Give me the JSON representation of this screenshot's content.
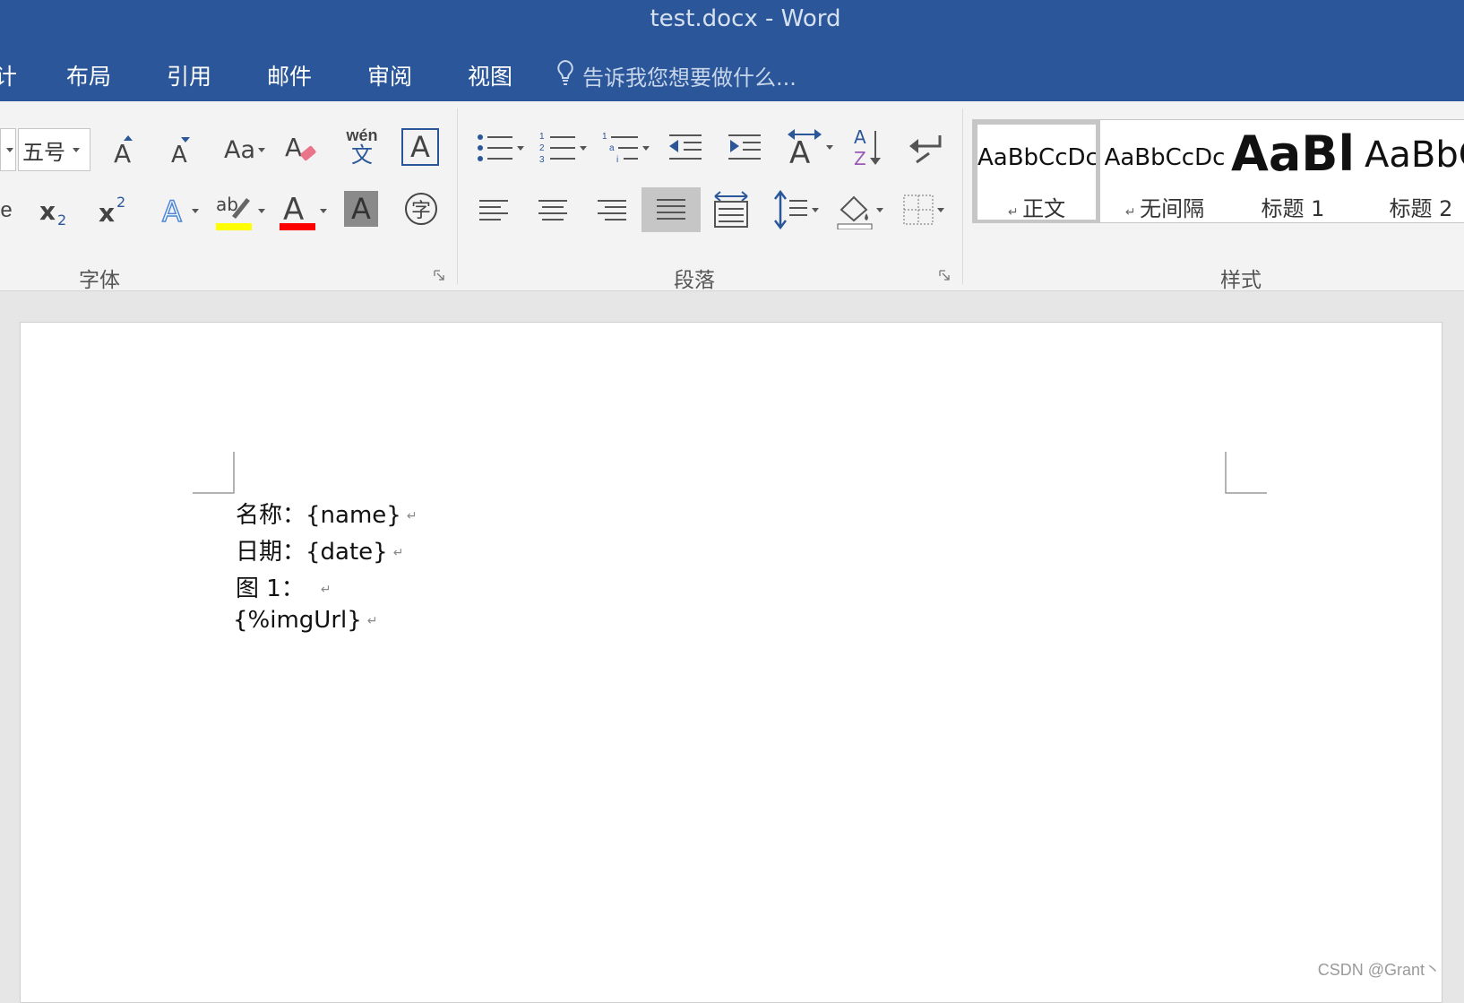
{
  "window": {
    "title": "test.docx - Word"
  },
  "tabs": [
    {
      "label": "计"
    },
    {
      "label": "布局"
    },
    {
      "label": "引用"
    },
    {
      "label": "邮件"
    },
    {
      "label": "审阅"
    },
    {
      "label": "视图"
    }
  ],
  "tell_me": {
    "text": "告诉我您想要做什么..."
  },
  "ribbon": {
    "font_group": {
      "label": "字体",
      "font_size": "五号",
      "change_case": "Aa",
      "phonetic_top": "wén",
      "phonetic_bottom": "文",
      "char_border": "A",
      "highlight_color": "#ffff00",
      "font_color": "#ff0000"
    },
    "paragraph_group": {
      "label": "段落"
    },
    "styles_group": {
      "label": "样式",
      "styles": [
        {
          "sample": "AaBbCcDc",
          "name": "正文",
          "selected": true
        },
        {
          "sample": "AaBbCcDc",
          "name": "无间隔",
          "selected": false
        },
        {
          "sample": "AaBl",
          "name": "标题 1",
          "selected": false
        },
        {
          "sample": "AaBbC",
          "name": "标题 2",
          "selected": false
        }
      ]
    }
  },
  "document": {
    "lines": [
      "名称：{name}",
      "日期：{date}",
      "图 1：",
      "{%imgUrl}"
    ]
  },
  "watermark": "CSDN @Grant丶",
  "colors": {
    "accent": "#2b579a",
    "ribbon_bg": "#f3f3f3",
    "canvas_bg": "#e6e6e6"
  }
}
